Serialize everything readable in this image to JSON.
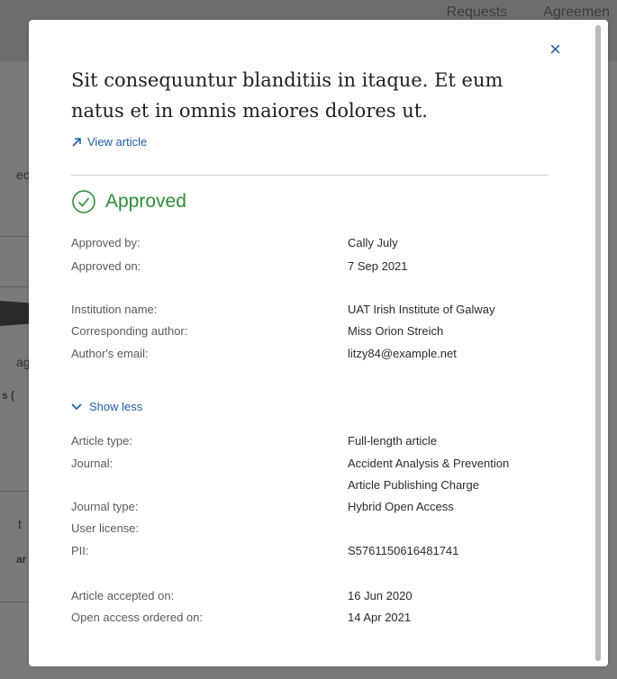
{
  "background": {
    "tabs": [
      "Requests",
      "Agreemen"
    ],
    "fragments": [
      "ec",
      "ag",
      "s (",
      "t",
      "ar"
    ]
  },
  "modal": {
    "close_label": "×",
    "title": "Sit consequuntur blanditiis in itaque. Et eum natus et in omnis maiores dolores ut.",
    "view_article": "View article",
    "status": {
      "label": "Approved",
      "color": "#2e8c3a",
      "icon": "check-circle-icon"
    },
    "approval": [
      {
        "label": "Approved by:",
        "value": "Cally July"
      },
      {
        "label": "Approved on:",
        "value": "7 Sep 2021"
      }
    ],
    "author": [
      {
        "label": "Institution name:",
        "value": "UAT Irish Institute of Galway"
      },
      {
        "label": "Corresponding author:",
        "value": "Miss Orion Streich"
      },
      {
        "label": "Author's email:",
        "value": "litzy84@example.net"
      }
    ],
    "toggle_label": "Show less",
    "article": [
      {
        "label": "Article type:",
        "value": "Full-length article"
      },
      {
        "label": "Journal:",
        "value": "Accident Analysis & Prevention"
      },
      {
        "label": "",
        "value": "Article Publishing Charge"
      },
      {
        "label": "Journal type:",
        "value": "Hybrid Open Access"
      },
      {
        "label": "User license:",
        "value": ""
      },
      {
        "label": "PII:",
        "value": "S5761150616481741"
      }
    ],
    "dates": [
      {
        "label": "Article accepted on:",
        "value": "16 Jun 2020"
      },
      {
        "label": "Open access ordered on:",
        "value": "14 Apr 2021"
      }
    ]
  }
}
